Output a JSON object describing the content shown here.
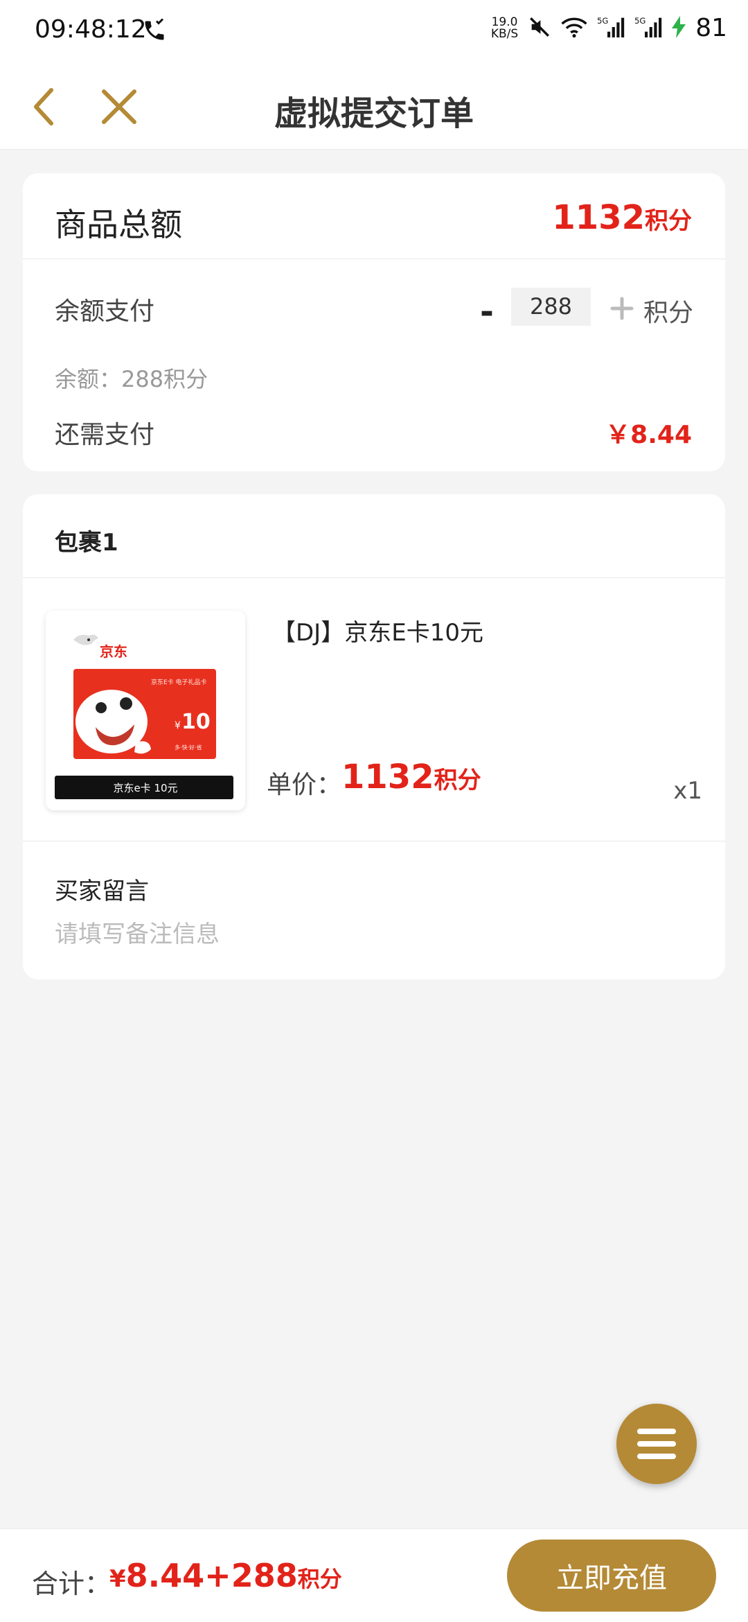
{
  "status_bar": {
    "time": "09:48:12",
    "net_speed_value": "19.0",
    "net_speed_unit": "KB/S",
    "battery": "81"
  },
  "nav": {
    "title": "虚拟提交订单",
    "icons": [
      "chevron-left-icon",
      "close-icon"
    ]
  },
  "summary": {
    "total_label": "商品总额",
    "total_amount": "1132",
    "total_unit": "积分",
    "balance_pay_label": "余额支付",
    "minus_label": "-",
    "points_value": "288",
    "points_unit": "积分",
    "balance_text": "余额：288积分",
    "need_pay_label": "还需支付",
    "need_pay_value": "￥8.44"
  },
  "package": {
    "title": "包裹1",
    "product": {
      "name": "【DJ】京东E卡10元",
      "price_label": "单价：",
      "price": "1132",
      "price_unit": "积分",
      "quantity": "x1",
      "image": {
        "brand": "京东",
        "card_header": "京东E卡 电子礼品卡",
        "currency": "¥",
        "value": "10",
        "slogan": "多·快·好·省",
        "caption": "京东e卡 10元"
      }
    },
    "message_label": "买家留言",
    "message_placeholder": "请填写备注信息"
  },
  "fab": {
    "icon": "menu-icon"
  },
  "bottom": {
    "total_label": "合计：",
    "currency": "¥",
    "amount": "8.44+288",
    "unit": "积分",
    "button": "立即充值"
  },
  "colors": {
    "accent": "#b48a36",
    "price_red": "#e2231a",
    "background": "#f4f4f4"
  }
}
